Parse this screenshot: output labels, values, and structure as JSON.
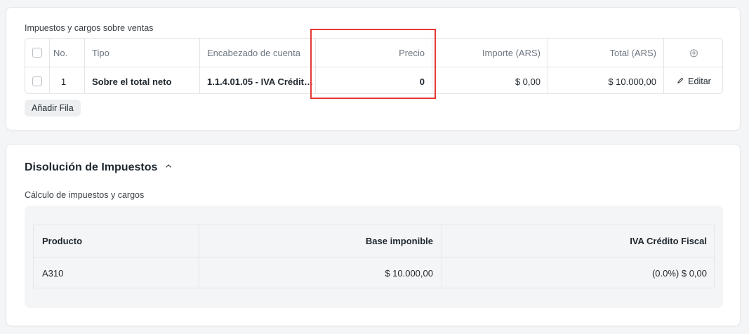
{
  "taxes_section": {
    "label": "Impuestos y cargos sobre ventas",
    "columns": {
      "no": "No.",
      "tipo": "Tipo",
      "encabezado": "Encabezado de cuenta",
      "precio": "Precio",
      "importe": "Importe (ARS)",
      "total": "Total (ARS)"
    },
    "rows": [
      {
        "no": "1",
        "tipo": "Sobre el total neto",
        "encabezado": "1.1.4.01.05 - IVA Crédit…",
        "precio": "0",
        "importe": "$ 0,00",
        "total": "$ 10.000,00",
        "action": "Editar"
      }
    ],
    "add_row_label": "Añadir Fila"
  },
  "breakdown_section": {
    "title": "Disolución de Impuestos",
    "sublabel": "Cálculo de impuestos y cargos",
    "headers": [
      "Producto",
      "Base imponible",
      "IVA Crédito Fiscal"
    ],
    "rows": [
      [
        "A310",
        "$ 10.000,00",
        "(0.0%) $ 0,00"
      ]
    ]
  },
  "colors": {
    "highlight": "#e53935"
  }
}
